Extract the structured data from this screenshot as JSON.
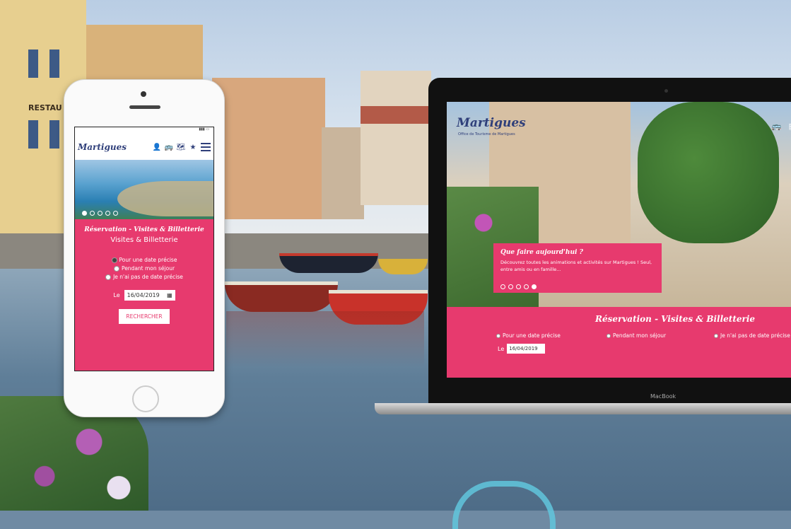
{
  "backdrop": {
    "sign_text": "RESTAU"
  },
  "phone": {
    "status": "▮▮▮ ▭",
    "logo": "Martigues",
    "nav_icons": [
      "user-icon",
      "bus-icon",
      "map-icon",
      "star-icon",
      "menu-icon"
    ],
    "nav_glyphs": [
      "👤",
      "🚌",
      "🗺",
      "★"
    ],
    "carousel_dots": 5,
    "carousel_active_dot": 0,
    "title": "Réservation - Visites & Billetterie",
    "subtitle": "Visites & Billetterie",
    "options": [
      "Pour une date précise",
      "Pendant mon séjour",
      "Je n'ai pas de date précise"
    ],
    "selected_option": 0,
    "date_label": "Le",
    "date_value": "16/04/2019",
    "search_button": "RECHERCHER"
  },
  "laptop": {
    "logo": "Martigues",
    "logo_sub": "Office de Tourisme de Martigues",
    "card_title": "Que faire aujourd'hui ?",
    "card_text": "Découvrez toutes les animations et activités sur Martigues ! Seul, entre amis ou en famille...",
    "carousel_dots": 5,
    "carousel_active_dot": 4,
    "section_title": "Réservation - Visites & Billetterie",
    "options": [
      "Pour une date précise",
      "Pendant mon séjour",
      "Je n'ai pas de date précise"
    ],
    "date_label": "Le",
    "date_value": "16/04/2019",
    "brand": "MacBook"
  },
  "colors": {
    "accent_pink": "#e73a6e",
    "brand_navy": "#2f3f7a",
    "heart_cyan": "#61c6dd"
  }
}
